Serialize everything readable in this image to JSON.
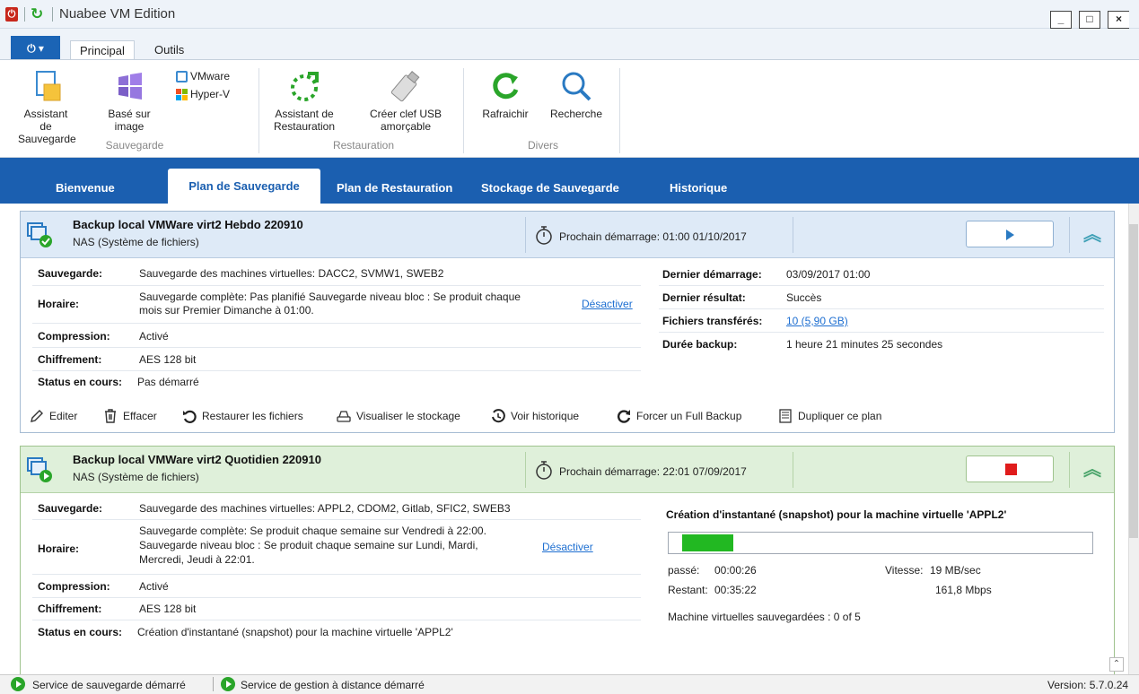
{
  "window": {
    "title": "Nuabee VM Edition",
    "minimize": "_",
    "maximize": "□",
    "close": "×"
  },
  "ribbon": {
    "tabs": [
      "Principal",
      "Outils"
    ],
    "groups": {
      "sauvegarde": "Sauvegarde",
      "restauration": "Restauration",
      "divers": "Divers"
    },
    "buttons": {
      "assistant_sauvegarde": "Assistant de Sauvegarde",
      "base_sur_image": "Basé sur image",
      "vmware": "VMware",
      "hyperv": "Hyper-V",
      "assistant_restauration": "Assistant de Restauration",
      "creer_clef": "Créer clef USB amorçable",
      "rafraichir": "Rafraichir",
      "recherche": "Recherche"
    }
  },
  "nav": {
    "tabs": [
      "Bienvenue",
      "Plan de Sauvegarde",
      "Plan de Restauration",
      "Stockage de Sauvegarde",
      "Historique"
    ],
    "active": "Plan de Sauvegarde"
  },
  "plan1": {
    "name": "Backup local VMWare virt2 Hebdo 220910",
    "storage": "NAS (Système de fichiers)",
    "next_start_label": "Prochain démarrage:",
    "next_start": "01:00 01/10/2017",
    "fields": {
      "sauvegarde_label": "Sauvegarde:",
      "sauvegarde": "Sauvegarde des machines virtuelles: DACC2, SVMW1, SWEB2",
      "horaire_label": "Horaire:",
      "horaire_line1": "Sauvegarde complète: Pas planifié Sauvegarde niveau bloc : Se produit chaque",
      "horaire_line2": "mois sur Premier Dimanche à 01:00.",
      "desactiver": "Désactiver",
      "compression_label": "Compression:",
      "compression": "Activé",
      "chiffrement_label": "Chiffrement:",
      "chiffrement": "AES 128 bit",
      "status_label": "Status en cours:",
      "status": "Pas démarré",
      "dernier_demarrage_label": "Dernier démarrage:",
      "dernier_demarrage": "03/09/2017 01:00",
      "dernier_resultat_label": "Dernier résultat:",
      "dernier_resultat": "Succès",
      "fichiers_label": "Fichiers transférés:",
      "fichiers": "10 (5,90 GB)",
      "duree_label": "Durée backup:",
      "duree": "1 heure 21 minutes 25 secondes"
    },
    "actions": [
      "Editer",
      "Effacer",
      "Restaurer les fichiers",
      "Visualiser le stockage",
      "Voir historique",
      "Forcer un Full Backup",
      "Dupliquer ce plan"
    ]
  },
  "plan2": {
    "name": "Backup local VMWare virt2 Quotidien 220910",
    "storage": "NAS (Système de fichiers)",
    "next_start_label": "Prochain démarrage:",
    "next_start": "22:01 07/09/2017",
    "fields": {
      "sauvegarde_label": "Sauvegarde:",
      "sauvegarde": "Sauvegarde des machines virtuelles: APPL2, CDOM2, Gitlab, SFIC2, SWEB3",
      "horaire_label": "Horaire:",
      "horaire_line1": "Sauvegarde complète: Se produit chaque semaine sur Vendredi à 22:00.",
      "horaire_line2": "Sauvegarde niveau bloc : Se produit chaque semaine sur Lundi, Mardi,",
      "horaire_line3": "Mercredi, Jeudi à 22:01.",
      "desactiver": "Désactiver",
      "compression_label": "Compression:",
      "compression": "Activé",
      "chiffrement_label": "Chiffrement:",
      "chiffrement": "AES 128 bit",
      "status_label": "Status en cours:",
      "status": "Création d'instantané (snapshot) pour la machine virtuelle 'APPL2'"
    },
    "progress": {
      "title": "Création d'instantané (snapshot) pour la machine virtuelle 'APPL2'",
      "fraction": 0.25,
      "passe_label": "passé:",
      "passe": "00:00:26",
      "restant_label": "Restant:",
      "restant": "00:35:22",
      "vitesse_label": "Vitesse:",
      "vitesse": "19 MB/sec",
      "mbps": "161,8 Mbps",
      "machines": "Machine virtuelles sauvegardées : 0 of 5"
    }
  },
  "status_bar": {
    "service1": "Service de sauvegarde démarré",
    "service2": "Service de gestion à distance démarré",
    "version": "Version: 5.7.0.24"
  },
  "colors": {
    "nav": "#1b5fb0",
    "progress": "#22b822",
    "accent_link": "#1e6fd1"
  }
}
